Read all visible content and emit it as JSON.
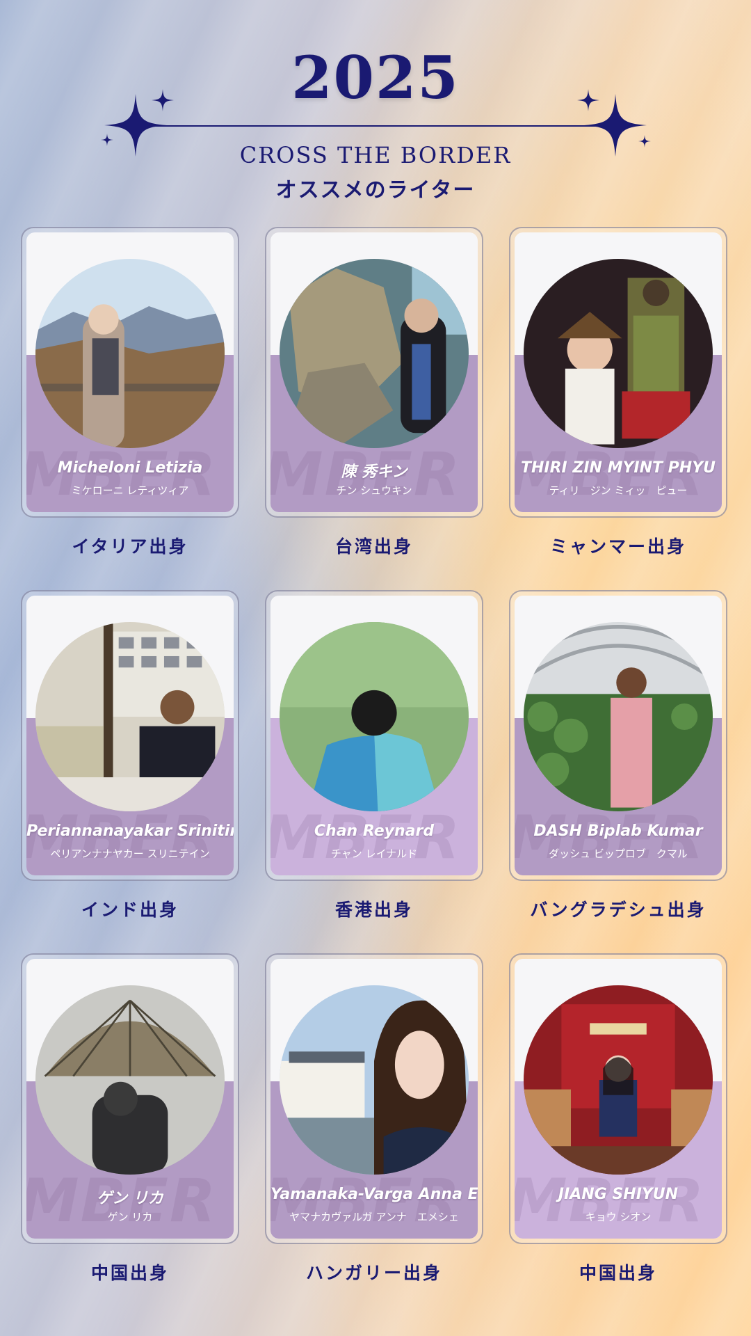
{
  "header": {
    "year": "2025",
    "subtitle": "CROSS THE BORDER",
    "subtitle_jp": "オススメのライター"
  },
  "colors": {
    "title_navy": "#1a1a72",
    "card_purple": "#b29bc4",
    "card_light_purple": "#cbb2dc",
    "card_top": "#f6f6f8"
  },
  "writers": [
    {
      "name": "Micheloni Letizia",
      "kana": "ミケローニ レティツィア",
      "origin": "イタリア出身",
      "photo": "woman-on-mountain-viewpoint"
    },
    {
      "name": "陳 秀キン",
      "kana": "チン シュウキン",
      "origin": "台湾出身",
      "photo": "woman-at-aquarium"
    },
    {
      "name": "THIRI ZIN MYINT PHYU",
      "kana": "ティリ　ジン ミィッ　ピュー",
      "origin": "ミャンマー出身",
      "photo": "person-with-samurai-armor"
    },
    {
      "name": "Periannanayakar Srinitin",
      "kana": "ペリアンナナヤカー スリニテイン",
      "origin": "インド出身",
      "photo": "man-waving-in-shop"
    },
    {
      "name": "Chan Reynard",
      "kana": "チャン レイナルド",
      "origin": "香港出身",
      "photo": "person-in-green-field"
    },
    {
      "name": "DASH Biplab Kumar",
      "kana": "ダッシュ ビップロブ　クマル",
      "origin": "バングラデシュ出身",
      "photo": "man-in-greenhouse"
    },
    {
      "name": "ゲン リカ",
      "kana": "ゲン リカ",
      "origin": "中国出身",
      "photo": "umbrella-in-snow"
    },
    {
      "name": "Yamanaka-Varga Anna Emese",
      "kana": "ヤマナカヴァルガ アンナ　エメシェ",
      "origin": "ハンガリー出身",
      "photo": "woman-at-harbor"
    },
    {
      "name": "JIANG SHIYUN",
      "kana": "キョウ シオン",
      "origin": "中国出身",
      "photo": "woman-at-ticket-booth"
    }
  ]
}
